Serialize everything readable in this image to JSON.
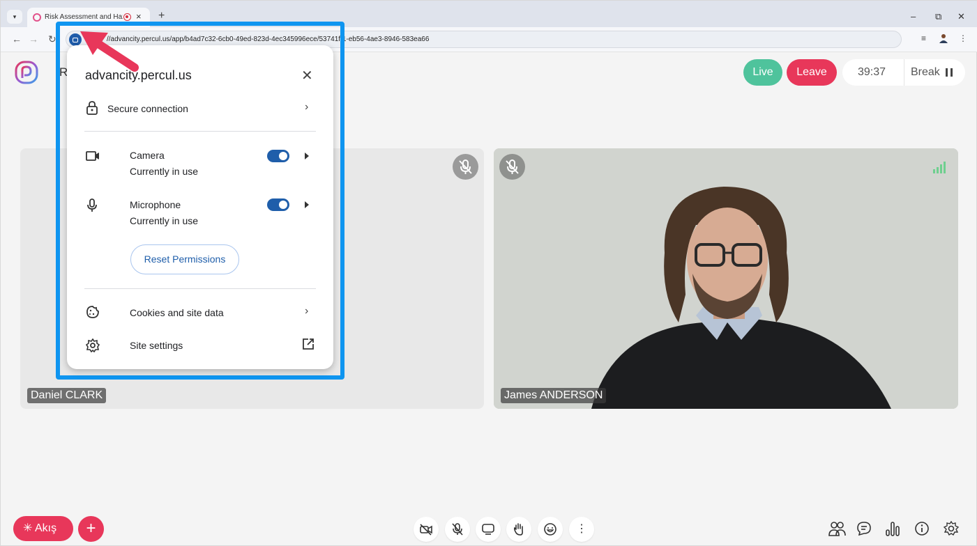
{
  "browser": {
    "tab_title": "Risk Assessment and Hazar",
    "tab_close": "×",
    "new_tab": "+",
    "url": "//advancity.percul.us/app/b4ad7c32-6cb0-49ed-823d-4ec345996ece/53741f 1-eb56-4ae3-8946-583ea66",
    "controls": {
      "minimize": "–",
      "restore": "⧉",
      "close": "✕"
    }
  },
  "app": {
    "title_partial": "Ris",
    "live_label": "Live",
    "leave_label": "Leave",
    "timer": "39:37",
    "break_label": "Break",
    "accent_color": "#e8375a",
    "live_color": "#4fc39c"
  },
  "participants": [
    {
      "name": "Daniel CLARK",
      "muted": true
    },
    {
      "name": "James ANDERSON",
      "muted": true
    }
  ],
  "bottom_bar": {
    "flow_label": "Akış",
    "add_label": "+",
    "more_label": "⋮"
  },
  "site_popup": {
    "domain": "advancity.percul.us",
    "close": "✕",
    "secure": "Secure connection",
    "camera": {
      "label": "Camera",
      "status": "Currently in use",
      "enabled": true
    },
    "microphone": {
      "label": "Microphone",
      "status": "Currently in use",
      "enabled": true
    },
    "reset_button": "Reset Permissions",
    "cookies": "Cookies and site data",
    "site_settings": "Site settings",
    "chevron": "›"
  }
}
